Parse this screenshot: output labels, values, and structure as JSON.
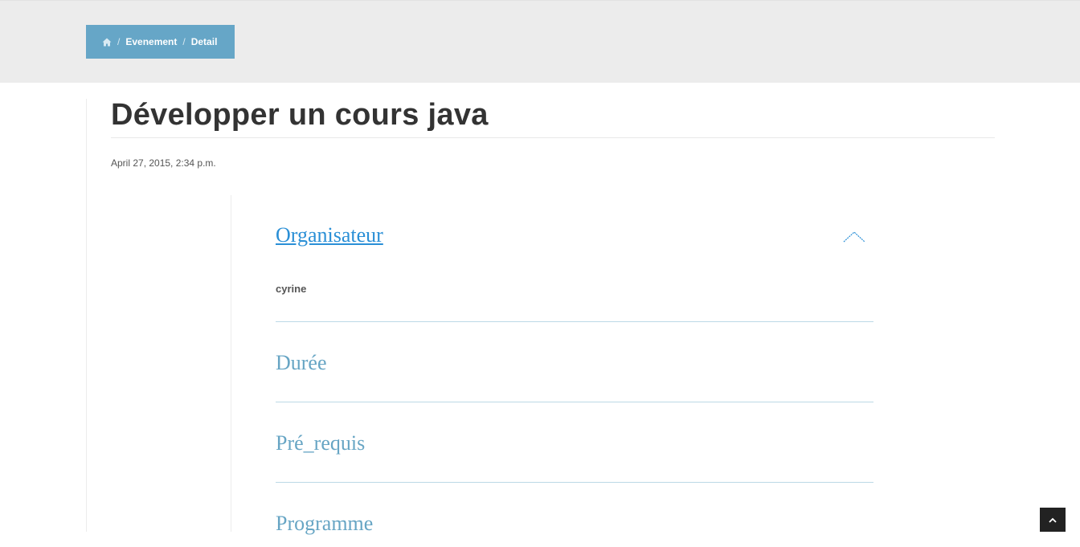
{
  "breadcrumb": {
    "home_icon": "home-icon",
    "items": [
      "Evenement",
      "Detail"
    ],
    "separator": "/",
    "background": "#66a6c7"
  },
  "page": {
    "title": "Développer un cours java",
    "date": "April 27, 2015, 2:34 p.m."
  },
  "accordion": {
    "items": [
      {
        "label": "Organisateur",
        "expanded": true,
        "content": "cyrine"
      },
      {
        "label": "Durée",
        "expanded": false
      },
      {
        "label": "Pré_requis",
        "expanded": false
      },
      {
        "label": "Programme",
        "expanded": false
      }
    ],
    "accent_color": "#2a8fd6",
    "title_color": "#67a5c4"
  },
  "scroll_top": {
    "icon": "chevron-up-icon"
  }
}
